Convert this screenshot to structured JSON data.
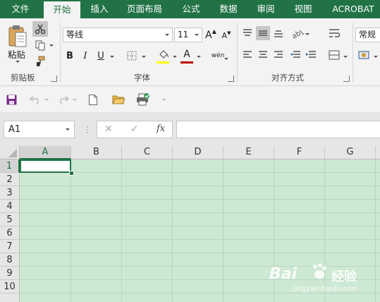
{
  "tabs": [
    {
      "label": "文件",
      "active": false
    },
    {
      "label": "开始",
      "active": true
    },
    {
      "label": "插入",
      "active": false
    },
    {
      "label": "页面布局",
      "active": false
    },
    {
      "label": "公式",
      "active": false
    },
    {
      "label": "数据",
      "active": false
    },
    {
      "label": "审阅",
      "active": false
    },
    {
      "label": "视图",
      "active": false
    },
    {
      "label": "ACROBAT",
      "active": false
    }
  ],
  "ribbon": {
    "clipboard": {
      "paste_label": "粘贴",
      "group_label": "剪贴板"
    },
    "font": {
      "font_name": "等线",
      "font_size": "11",
      "bold": "B",
      "italic": "I",
      "underline": "U",
      "grow": "A",
      "shrink": "A",
      "font_color_letter": "A",
      "phonetic": "wén",
      "group_label": "字体",
      "fill_color": "#ffff00",
      "font_color": "#c00000"
    },
    "alignment": {
      "group_label": "对齐方式"
    },
    "number": {
      "format": "常规"
    }
  },
  "formula_bar": {
    "name_box": "A1",
    "cancel_glyph": "✕",
    "enter_glyph": "✓",
    "fx_label": "fx",
    "formula": ""
  },
  "grid": {
    "columns": [
      "A",
      "B",
      "C",
      "D",
      "E",
      "F",
      "G"
    ],
    "rows": [
      "1",
      "2",
      "3",
      "4",
      "5",
      "6",
      "7",
      "8",
      "9",
      "10"
    ],
    "active_cell": "A1",
    "background": "#cde8d3"
  },
  "watermark": {
    "brand": "Bai",
    "product": "经验",
    "url": "jingyan.baidu.com"
  },
  "colors": {
    "accent": "#217346",
    "ribbon_bg": "#f3f3f3"
  }
}
